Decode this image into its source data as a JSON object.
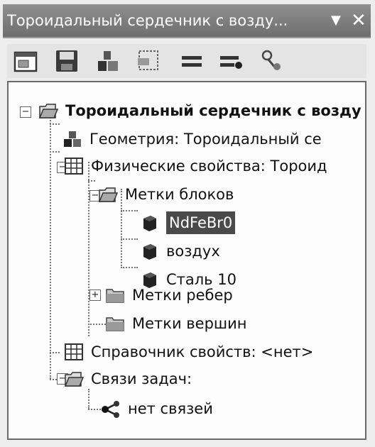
{
  "window": {
    "title": "Тороидальный сердечник с возду...",
    "pin_glyph": "▼",
    "close_glyph": "✕"
  },
  "toolbar": {
    "buttons": [
      "properties-icon",
      "save-icon",
      "geometry-icon",
      "dock-icon",
      "equals-icon",
      "equals-arrow-icon",
      "link-icon"
    ]
  },
  "tree": {
    "root": "Тороидальный сердечник с возду",
    "geometry": "Геометрия: Тороидальный се",
    "physics": "Физические свойства: Тороид",
    "block_labels": "Метки блоков",
    "blocks": [
      "NdFeBr0",
      "воздух",
      "Сталь 10"
    ],
    "edge_labels": "Метки ребер",
    "vertex_labels": "Метки вершин",
    "reference": "Справочник свойств: <нет>",
    "links": "Связи задач:",
    "no_links": "нет связей"
  }
}
